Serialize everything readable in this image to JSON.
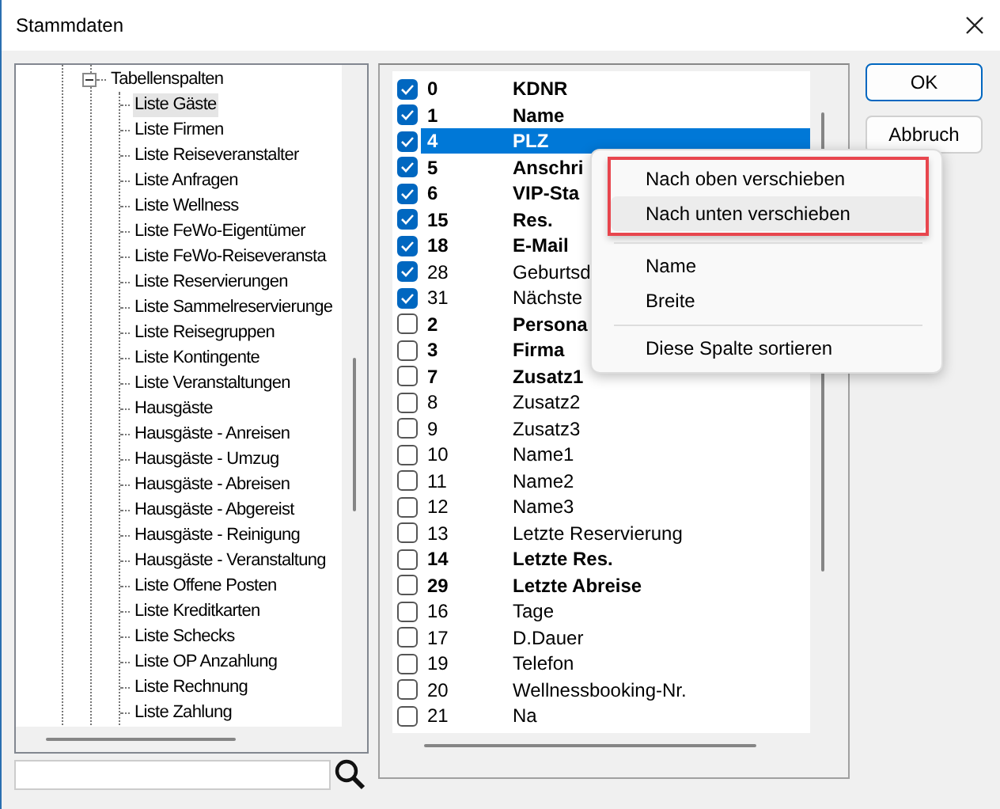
{
  "window": {
    "title": "Stammdaten"
  },
  "tree": {
    "items": [
      {
        "label": "Tabellenspalten",
        "expanded": true,
        "selected": false,
        "children": [
          {
            "label": "Liste Gäste",
            "selected": true
          },
          {
            "label": "Liste Firmen",
            "selected": false
          },
          {
            "label": "Liste Reiseveranstalter",
            "selected": false
          },
          {
            "label": "Liste Anfragen",
            "selected": false
          },
          {
            "label": "Liste Wellness",
            "selected": false
          },
          {
            "label": "Liste FeWo-Eigentümer",
            "selected": false
          },
          {
            "label": "Liste FeWo-Reiseveransta",
            "selected": false
          },
          {
            "label": "Liste Reservierungen",
            "selected": false
          },
          {
            "label": "Liste Sammelreservierunge",
            "selected": false
          },
          {
            "label": "Liste Reisegruppen",
            "selected": false
          },
          {
            "label": "Liste Kontingente",
            "selected": false
          },
          {
            "label": "Liste Veranstaltungen",
            "selected": false
          },
          {
            "label": "Hausgäste",
            "selected": false
          },
          {
            "label": "Hausgäste - Anreisen",
            "selected": false
          },
          {
            "label": "Hausgäste - Umzug",
            "selected": false
          },
          {
            "label": "Hausgäste - Abreisen",
            "selected": false
          },
          {
            "label": "Hausgäste - Abgereist",
            "selected": false
          },
          {
            "label": "Hausgäste - Reinigung",
            "selected": false
          },
          {
            "label": "Hausgäste - Veranstaltung",
            "selected": false
          },
          {
            "label": "Liste Offene Posten",
            "selected": false
          },
          {
            "label": "Liste Kreditkarten",
            "selected": false
          },
          {
            "label": "Liste Schecks",
            "selected": false
          },
          {
            "label": "Liste OP Anzahlung",
            "selected": false
          },
          {
            "label": "Liste Rechnung",
            "selected": false
          },
          {
            "label": "Liste Zahlung",
            "selected": false
          }
        ]
      }
    ]
  },
  "columns": [
    {
      "number": "0",
      "name": "KDNR",
      "checked": true,
      "bold": true,
      "selected": false
    },
    {
      "number": "1",
      "name": "Name",
      "checked": true,
      "bold": true,
      "selected": false
    },
    {
      "number": "4",
      "name": "PLZ",
      "checked": true,
      "bold": true,
      "selected": true
    },
    {
      "number": "5",
      "name": "Anschri",
      "checked": true,
      "bold": true,
      "selected": false
    },
    {
      "number": "6",
      "name": "VIP-Sta",
      "checked": true,
      "bold": true,
      "selected": false
    },
    {
      "number": "15",
      "name": "Res.",
      "checked": true,
      "bold": true,
      "selected": false
    },
    {
      "number": "18",
      "name": "E-Mail",
      "checked": true,
      "bold": true,
      "selected": false
    },
    {
      "number": "28",
      "name": "Geburtsd",
      "checked": true,
      "bold": false,
      "selected": false
    },
    {
      "number": "31",
      "name": "Nächste",
      "checked": true,
      "bold": false,
      "selected": false
    },
    {
      "number": "2",
      "name": "Persona",
      "checked": false,
      "bold": true,
      "selected": false
    },
    {
      "number": "3",
      "name": "Firma",
      "checked": false,
      "bold": true,
      "selected": false
    },
    {
      "number": "7",
      "name": "Zusatz1",
      "checked": false,
      "bold": true,
      "selected": false
    },
    {
      "number": "8",
      "name": "Zusatz2",
      "checked": false,
      "bold": false,
      "selected": false
    },
    {
      "number": "9",
      "name": "Zusatz3",
      "checked": false,
      "bold": false,
      "selected": false
    },
    {
      "number": "10",
      "name": "Name1",
      "checked": false,
      "bold": false,
      "selected": false
    },
    {
      "number": "11",
      "name": "Name2",
      "checked": false,
      "bold": false,
      "selected": false
    },
    {
      "number": "12",
      "name": "Name3",
      "checked": false,
      "bold": false,
      "selected": false
    },
    {
      "number": "13",
      "name": "Letzte Reservierung",
      "checked": false,
      "bold": false,
      "selected": false
    },
    {
      "number": "14",
      "name": "Letzte Res.",
      "checked": false,
      "bold": true,
      "selected": false
    },
    {
      "number": "29",
      "name": "Letzte Abreise",
      "checked": false,
      "bold": true,
      "selected": false
    },
    {
      "number": "16",
      "name": "Tage",
      "checked": false,
      "bold": false,
      "selected": false
    },
    {
      "number": "17",
      "name": "D.Dauer",
      "checked": false,
      "bold": false,
      "selected": false
    },
    {
      "number": "19",
      "name": "Telefon",
      "checked": false,
      "bold": false,
      "selected": false
    },
    {
      "number": "20",
      "name": "Wellnessbooking-Nr.",
      "checked": false,
      "bold": false,
      "selected": false
    },
    {
      "number": "21",
      "name": "Na",
      "checked": false,
      "bold": false,
      "selected": false
    }
  ],
  "buttons": [
    {
      "label": "OK",
      "default": true
    },
    {
      "label": "Abbruch",
      "default": false
    }
  ],
  "context_menu": {
    "entries": [
      {
        "kind": "item",
        "label": "Nach oben verschieben",
        "hovered": false,
        "marked": true
      },
      {
        "kind": "item",
        "label": "Nach unten verschieben",
        "hovered": true,
        "marked": true
      },
      {
        "kind": "separator"
      },
      {
        "kind": "item",
        "label": "Name",
        "hovered": false,
        "marked": false
      },
      {
        "kind": "item",
        "label": "Breite",
        "hovered": false,
        "marked": false
      },
      {
        "kind": "separator"
      },
      {
        "kind": "item",
        "label": "Diese Spalte sortieren",
        "hovered": false,
        "marked": false
      }
    ]
  }
}
